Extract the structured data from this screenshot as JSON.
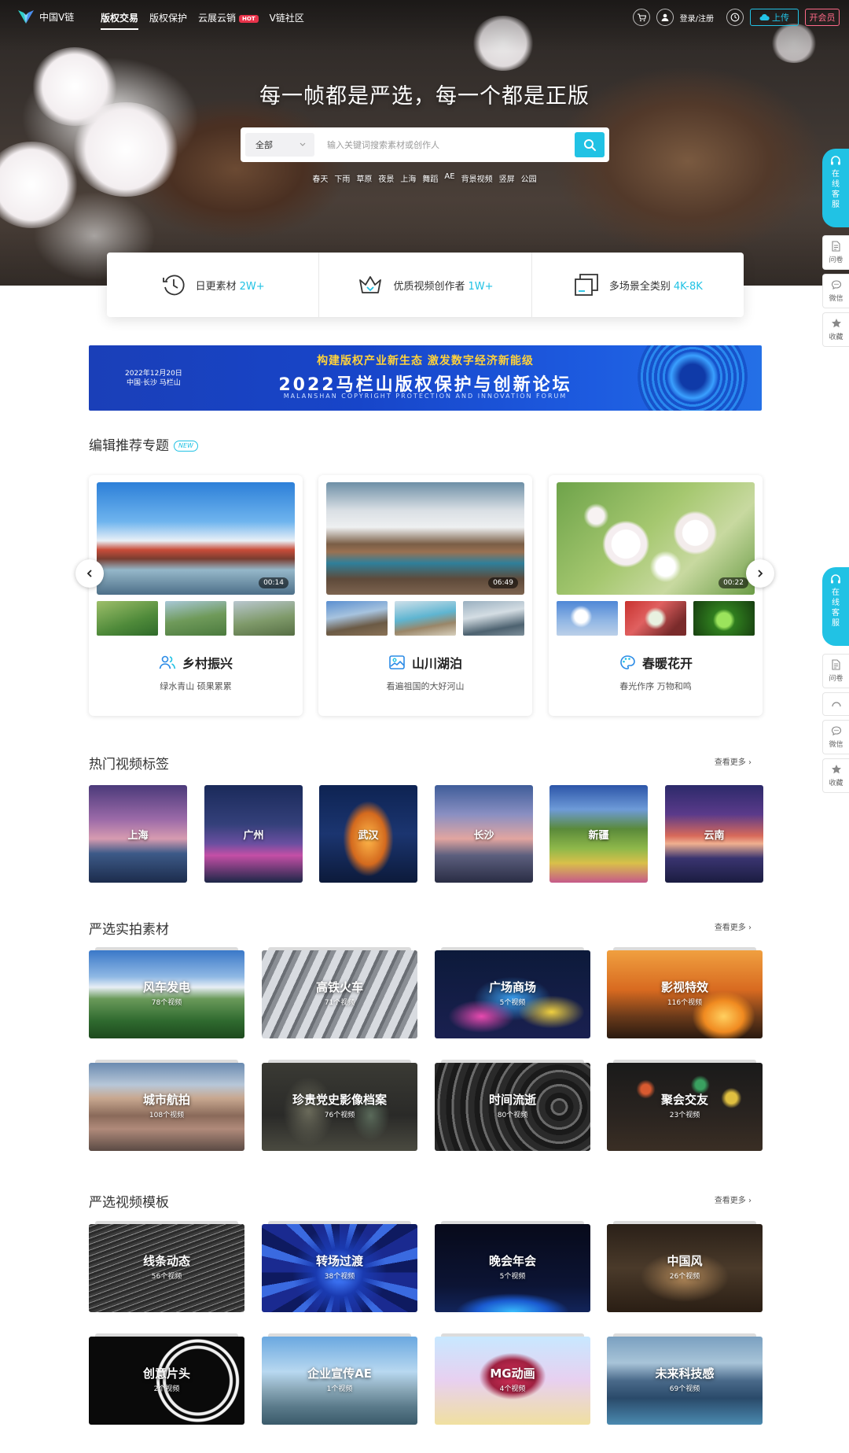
{
  "nav": {
    "logo_text": "中国V链",
    "items": [
      "版权交易",
      "版权保护",
      "云展云销",
      "V链社区"
    ],
    "hot_badge": "HOT",
    "login": "登录/注册",
    "upload": "上传",
    "vip": "开会员"
  },
  "hero": {
    "slogan": "每一帧都是严选，每一个都是正版",
    "search_category": "全部",
    "search_placeholder": "输入关键词搜索素材或创作人",
    "hot_tags": [
      "春天",
      "下雨",
      "草原",
      "夜景",
      "上海",
      "舞蹈",
      "AE",
      "背景视频",
      "竖屏",
      "公园"
    ]
  },
  "stats": [
    {
      "label": "日更素材",
      "value": "2W+",
      "icon": "clock-icon"
    },
    {
      "label": "优质视频创作者",
      "value": "1W+",
      "icon": "crown-icon"
    },
    {
      "label": "多场景全类别",
      "value": "4K-8K",
      "icon": "layers-icon"
    }
  ],
  "banner": {
    "date_line1": "2022年12月20日",
    "date_line2": "中国·长沙 马栏山",
    "top_line": "构建版权产业新生态  激发数字经济新能级",
    "title": "2022马栏山版权保护与创新论坛",
    "subtitle": "MALANSHAN COPYRIGHT PROTECTION AND INNOVATION FORUM"
  },
  "sections": {
    "editor_topics": "编辑推荐专题",
    "new_badge": "NEW",
    "hot_tags": "热门视频标签",
    "real_footage": "严选实拍素材",
    "templates": "严选视频模板",
    "more": "查看更多 ›"
  },
  "topics": [
    {
      "title": "乡村振兴",
      "subtitle": "绿水青山 硕果累累",
      "duration": "00:14",
      "icon": "people-icon"
    },
    {
      "title": "山川湖泊",
      "subtitle": "看遍祖国的大好河山",
      "duration": "06:49",
      "icon": "picture-icon"
    },
    {
      "title": "春暖花开",
      "subtitle": "春光作序 万物和鸣",
      "duration": "00:22",
      "icon": "palette-icon"
    }
  ],
  "cities": [
    "上海",
    "广州",
    "武汉",
    "长沙",
    "新疆",
    "云南"
  ],
  "footage": [
    {
      "label": "风车发电",
      "count": "78个视频"
    },
    {
      "label": "高铁火车",
      "count": "71个视频"
    },
    {
      "label": "广场商场",
      "count": "5个视频"
    },
    {
      "label": "影视特效",
      "count": "116个视频"
    },
    {
      "label": "城市航拍",
      "count": "108个视频"
    },
    {
      "label": "珍贵党史影像档案",
      "count": "76个视频"
    },
    {
      "label": "时间流逝",
      "count": "80个视频"
    },
    {
      "label": "聚会交友",
      "count": "23个视频"
    }
  ],
  "templates": [
    {
      "label": "线条动态",
      "count": "56个视频"
    },
    {
      "label": "转场过渡",
      "count": "38个视频"
    },
    {
      "label": "晚会年会",
      "count": "5个视频"
    },
    {
      "label": "中国风",
      "count": "26个视频"
    },
    {
      "label": "创意片头",
      "count": "2个视频"
    },
    {
      "label": "企业宣传AE",
      "count": "1个视频"
    },
    {
      "label": "MG动画",
      "count": "4个视频"
    },
    {
      "label": "未来科技感",
      "count": "69个视频"
    }
  ],
  "float_tools": {
    "cs": [
      "在",
      "线",
      "客",
      "服"
    ],
    "survey": "问卷",
    "wechat": "微信",
    "favorite": "收藏"
  },
  "colors": {
    "accent": "#21c2e4",
    "hot": "#e8334a",
    "vip": "#ff6a88"
  }
}
